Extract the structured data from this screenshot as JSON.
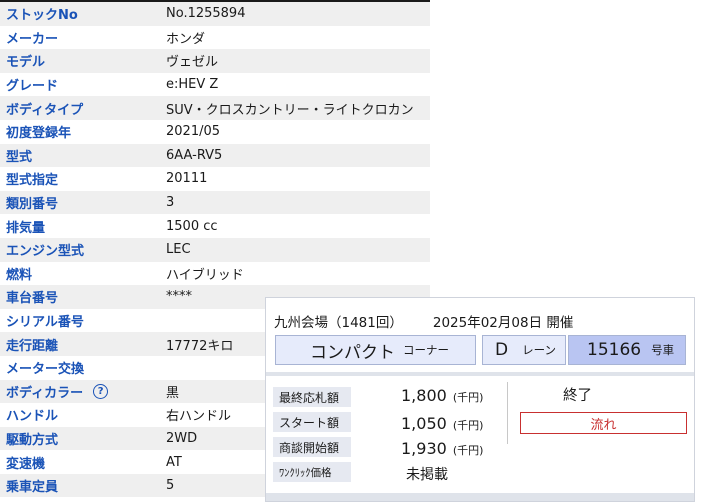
{
  "spec": [
    {
      "label": "ストックNo",
      "value": "No.1255894"
    },
    {
      "label": "メーカー",
      "value": "ホンダ"
    },
    {
      "label": "モデル",
      "value": "ヴェゼル"
    },
    {
      "label": "グレード",
      "value": "e:HEV Z"
    },
    {
      "label": "ボディタイプ",
      "value": "SUV・クロスカントリー・ライトクロカン"
    },
    {
      "label": "初度登録年",
      "value": "2021/05"
    },
    {
      "label": "型式",
      "value": "6AA-RV5"
    },
    {
      "label": "型式指定",
      "value": "20111"
    },
    {
      "label": "類別番号",
      "value": "3"
    },
    {
      "label": "排気量",
      "value": "1500 cc"
    },
    {
      "label": "エンジン型式",
      "value": "LEC"
    },
    {
      "label": "燃料",
      "value": "ハイブリッド"
    },
    {
      "label": "車台番号",
      "value": "****"
    },
    {
      "label": "シリアル番号",
      "value": ""
    },
    {
      "label": "走行距離",
      "value": "17772キロ"
    },
    {
      "label": "メーター交換",
      "value": ""
    },
    {
      "label": "ボディカラー",
      "value": "黒",
      "help": "?"
    },
    {
      "label": "ハンドル",
      "value": "右ハンドル"
    },
    {
      "label": "駆動方式",
      "value": "2WD"
    },
    {
      "label": "変速機",
      "value": "AT"
    },
    {
      "label": "乗車定員",
      "value": "5"
    }
  ],
  "auction": {
    "venue": "九州会場（1481回）",
    "date": "2025年02月08日 開催",
    "corner_name": "コンパクト",
    "corner_suffix": "コーナー",
    "lane_name": "D",
    "lane_suffix": "レーン",
    "car_number": "15166",
    "car_suffix": "号車",
    "prices": [
      {
        "label": "最終応札額",
        "value": "1,800",
        "unit": "(千円)"
      },
      {
        "label": "スタート額",
        "value": "1,050",
        "unit": "(千円)"
      },
      {
        "label": "商談開始額",
        "value": "1,930",
        "unit": "(千円)"
      },
      {
        "label": "ﾜﾝｸﾘｯｸ価格",
        "value": "未掲載",
        "unit": ""
      }
    ],
    "status": "終了",
    "result_button": "流れ"
  }
}
